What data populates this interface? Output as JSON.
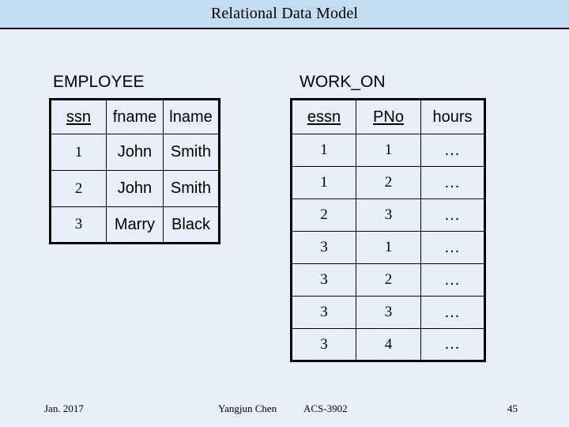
{
  "slide": {
    "title": "Relational Data Model",
    "band_color": "#c3dcf2",
    "background_color": "#e8eefa"
  },
  "employee_relation": {
    "caption": "EMPLOYEE",
    "headers": [
      {
        "label": "ssn",
        "is_key": true
      },
      {
        "label": "fname",
        "is_key": false
      },
      {
        "label": "lname",
        "is_key": false
      }
    ],
    "rows": [
      {
        "ssn": "1",
        "fname": "John",
        "lname": "Smith"
      },
      {
        "ssn": "2",
        "fname": "John",
        "lname": "Smith"
      },
      {
        "ssn": "3",
        "fname": "Marry",
        "lname": "Black"
      }
    ]
  },
  "workon_relation": {
    "caption": "WORK_ON",
    "headers": [
      {
        "label": "essn",
        "is_key": true
      },
      {
        "label": "PNo",
        "is_key": true
      },
      {
        "label": "hours",
        "is_key": false
      }
    ],
    "rows": [
      {
        "essn": "1",
        "pno": "1",
        "hours": "..."
      },
      {
        "essn": "1",
        "pno": "2",
        "hours": "..."
      },
      {
        "essn": "2",
        "pno": "3",
        "hours": "..."
      },
      {
        "essn": "3",
        "pno": "1",
        "hours": "..."
      },
      {
        "essn": "3",
        "pno": "2",
        "hours": "..."
      },
      {
        "essn": "3",
        "pno": "3",
        "hours": "..."
      },
      {
        "essn": "3",
        "pno": "4",
        "hours": "..."
      }
    ]
  },
  "footer": {
    "date": "Jan. 2017",
    "author": "Yangjun Chen",
    "course": "ACS-3902",
    "page_number": "45"
  }
}
